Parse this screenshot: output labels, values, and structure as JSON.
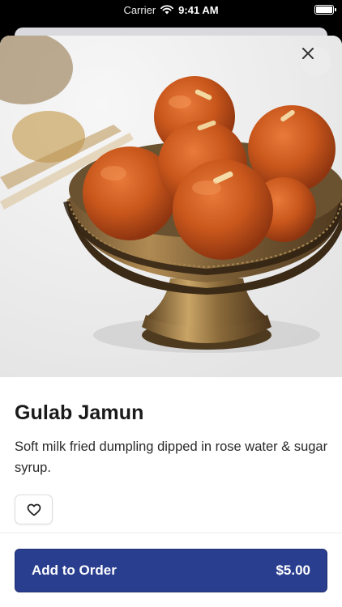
{
  "status_bar": {
    "carrier": "Carrier",
    "time": "9:41 AM"
  },
  "item": {
    "name": "Gulab Jamun",
    "description": "Soft milk fried dumpling dipped in rose water & sugar syrup.",
    "image_icon": "gulab-jamun-photo"
  },
  "actions": {
    "add_label": "Add to Order",
    "price": "$5.00",
    "close_icon": "close-icon",
    "favorite_icon": "heart-icon"
  },
  "colors": {
    "primary_button": "#2a3e8f",
    "text": "#1a1a1a"
  }
}
